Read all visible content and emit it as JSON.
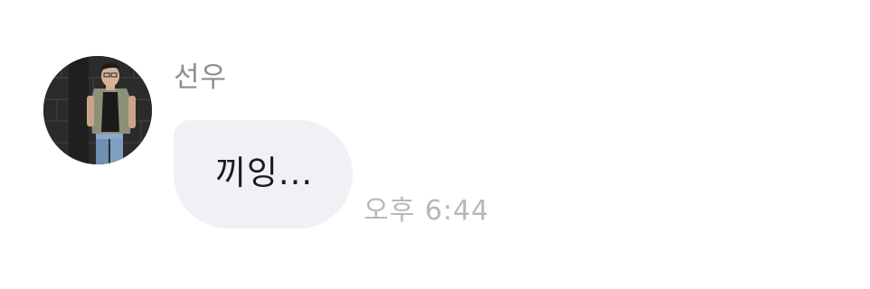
{
  "message": {
    "sender_name": "선우",
    "avatar_icon": "profile-photo",
    "text": "끼잉...",
    "timestamp": "오후 6:44"
  },
  "colors": {
    "bubble_background": "#f1f1f5",
    "sender_name": "#8e8e93",
    "message_text": "#1c1c1e",
    "timestamp": "#b7b7bc",
    "page_background": "#ffffff"
  }
}
